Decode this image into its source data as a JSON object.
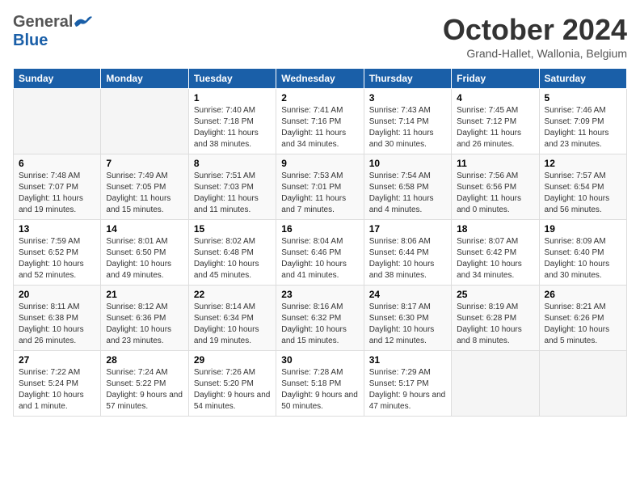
{
  "header": {
    "logo": {
      "part1": "General",
      "part2": "Blue"
    },
    "title": "October 2024",
    "subtitle": "Grand-Hallet, Wallonia, Belgium"
  },
  "calendar": {
    "weekdays": [
      "Sunday",
      "Monday",
      "Tuesday",
      "Wednesday",
      "Thursday",
      "Friday",
      "Saturday"
    ],
    "weeks": [
      [
        {
          "day": "",
          "info": ""
        },
        {
          "day": "",
          "info": ""
        },
        {
          "day": "1",
          "info": "Sunrise: 7:40 AM\nSunset: 7:18 PM\nDaylight: 11 hours and 38 minutes."
        },
        {
          "day": "2",
          "info": "Sunrise: 7:41 AM\nSunset: 7:16 PM\nDaylight: 11 hours and 34 minutes."
        },
        {
          "day": "3",
          "info": "Sunrise: 7:43 AM\nSunset: 7:14 PM\nDaylight: 11 hours and 30 minutes."
        },
        {
          "day": "4",
          "info": "Sunrise: 7:45 AM\nSunset: 7:12 PM\nDaylight: 11 hours and 26 minutes."
        },
        {
          "day": "5",
          "info": "Sunrise: 7:46 AM\nSunset: 7:09 PM\nDaylight: 11 hours and 23 minutes."
        }
      ],
      [
        {
          "day": "6",
          "info": "Sunrise: 7:48 AM\nSunset: 7:07 PM\nDaylight: 11 hours and 19 minutes."
        },
        {
          "day": "7",
          "info": "Sunrise: 7:49 AM\nSunset: 7:05 PM\nDaylight: 11 hours and 15 minutes."
        },
        {
          "day": "8",
          "info": "Sunrise: 7:51 AM\nSunset: 7:03 PM\nDaylight: 11 hours and 11 minutes."
        },
        {
          "day": "9",
          "info": "Sunrise: 7:53 AM\nSunset: 7:01 PM\nDaylight: 11 hours and 7 minutes."
        },
        {
          "day": "10",
          "info": "Sunrise: 7:54 AM\nSunset: 6:58 PM\nDaylight: 11 hours and 4 minutes."
        },
        {
          "day": "11",
          "info": "Sunrise: 7:56 AM\nSunset: 6:56 PM\nDaylight: 11 hours and 0 minutes."
        },
        {
          "day": "12",
          "info": "Sunrise: 7:57 AM\nSunset: 6:54 PM\nDaylight: 10 hours and 56 minutes."
        }
      ],
      [
        {
          "day": "13",
          "info": "Sunrise: 7:59 AM\nSunset: 6:52 PM\nDaylight: 10 hours and 52 minutes."
        },
        {
          "day": "14",
          "info": "Sunrise: 8:01 AM\nSunset: 6:50 PM\nDaylight: 10 hours and 49 minutes."
        },
        {
          "day": "15",
          "info": "Sunrise: 8:02 AM\nSunset: 6:48 PM\nDaylight: 10 hours and 45 minutes."
        },
        {
          "day": "16",
          "info": "Sunrise: 8:04 AM\nSunset: 6:46 PM\nDaylight: 10 hours and 41 minutes."
        },
        {
          "day": "17",
          "info": "Sunrise: 8:06 AM\nSunset: 6:44 PM\nDaylight: 10 hours and 38 minutes."
        },
        {
          "day": "18",
          "info": "Sunrise: 8:07 AM\nSunset: 6:42 PM\nDaylight: 10 hours and 34 minutes."
        },
        {
          "day": "19",
          "info": "Sunrise: 8:09 AM\nSunset: 6:40 PM\nDaylight: 10 hours and 30 minutes."
        }
      ],
      [
        {
          "day": "20",
          "info": "Sunrise: 8:11 AM\nSunset: 6:38 PM\nDaylight: 10 hours and 26 minutes."
        },
        {
          "day": "21",
          "info": "Sunrise: 8:12 AM\nSunset: 6:36 PM\nDaylight: 10 hours and 23 minutes."
        },
        {
          "day": "22",
          "info": "Sunrise: 8:14 AM\nSunset: 6:34 PM\nDaylight: 10 hours and 19 minutes."
        },
        {
          "day": "23",
          "info": "Sunrise: 8:16 AM\nSunset: 6:32 PM\nDaylight: 10 hours and 15 minutes."
        },
        {
          "day": "24",
          "info": "Sunrise: 8:17 AM\nSunset: 6:30 PM\nDaylight: 10 hours and 12 minutes."
        },
        {
          "day": "25",
          "info": "Sunrise: 8:19 AM\nSunset: 6:28 PM\nDaylight: 10 hours and 8 minutes."
        },
        {
          "day": "26",
          "info": "Sunrise: 8:21 AM\nSunset: 6:26 PM\nDaylight: 10 hours and 5 minutes."
        }
      ],
      [
        {
          "day": "27",
          "info": "Sunrise: 7:22 AM\nSunset: 5:24 PM\nDaylight: 10 hours and 1 minute."
        },
        {
          "day": "28",
          "info": "Sunrise: 7:24 AM\nSunset: 5:22 PM\nDaylight: 9 hours and 57 minutes."
        },
        {
          "day": "29",
          "info": "Sunrise: 7:26 AM\nSunset: 5:20 PM\nDaylight: 9 hours and 54 minutes."
        },
        {
          "day": "30",
          "info": "Sunrise: 7:28 AM\nSunset: 5:18 PM\nDaylight: 9 hours and 50 minutes."
        },
        {
          "day": "31",
          "info": "Sunrise: 7:29 AM\nSunset: 5:17 PM\nDaylight: 9 hours and 47 minutes."
        },
        {
          "day": "",
          "info": ""
        },
        {
          "day": "",
          "info": ""
        }
      ]
    ]
  }
}
